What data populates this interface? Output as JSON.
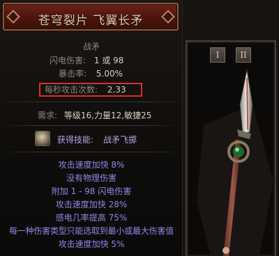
{
  "tooltip": {
    "title": "苍穹裂片 飞翼长矛",
    "subtype": "战矛",
    "stats": {
      "lightning_label": "闪电伤害:",
      "lightning_value": "1 或 98",
      "crit_label": "暴击率:",
      "crit_value": "5.00%",
      "aps_label": "每秒攻击次数:",
      "aps_value": "2.33"
    },
    "requirements": {
      "label": "需求:",
      "level": "等级16,",
      "str": "力量12,",
      "dex": "敏捷25"
    },
    "skill": {
      "label": "获得技能:",
      "name": "战矛飞掷",
      "icon": "spear-throw-icon"
    },
    "mods": [
      "攻击速度加快 8%",
      "没有物理伤害",
      "附加 1 - 98 闪电伤害",
      "攻击速度加快 28%",
      "感电几率提高 75%",
      "每一种伤害类型只能选取到最小或最大伤害值",
      "攻击速度加快 5%"
    ]
  },
  "weapon_panel": {
    "swap_1": "I",
    "swap_2": "II",
    "item_icon": "spear-icon"
  },
  "colors": {
    "title_bg": "#4a150e",
    "mod_text": "#8f87e6",
    "highlight_box": "#e12c2c"
  }
}
